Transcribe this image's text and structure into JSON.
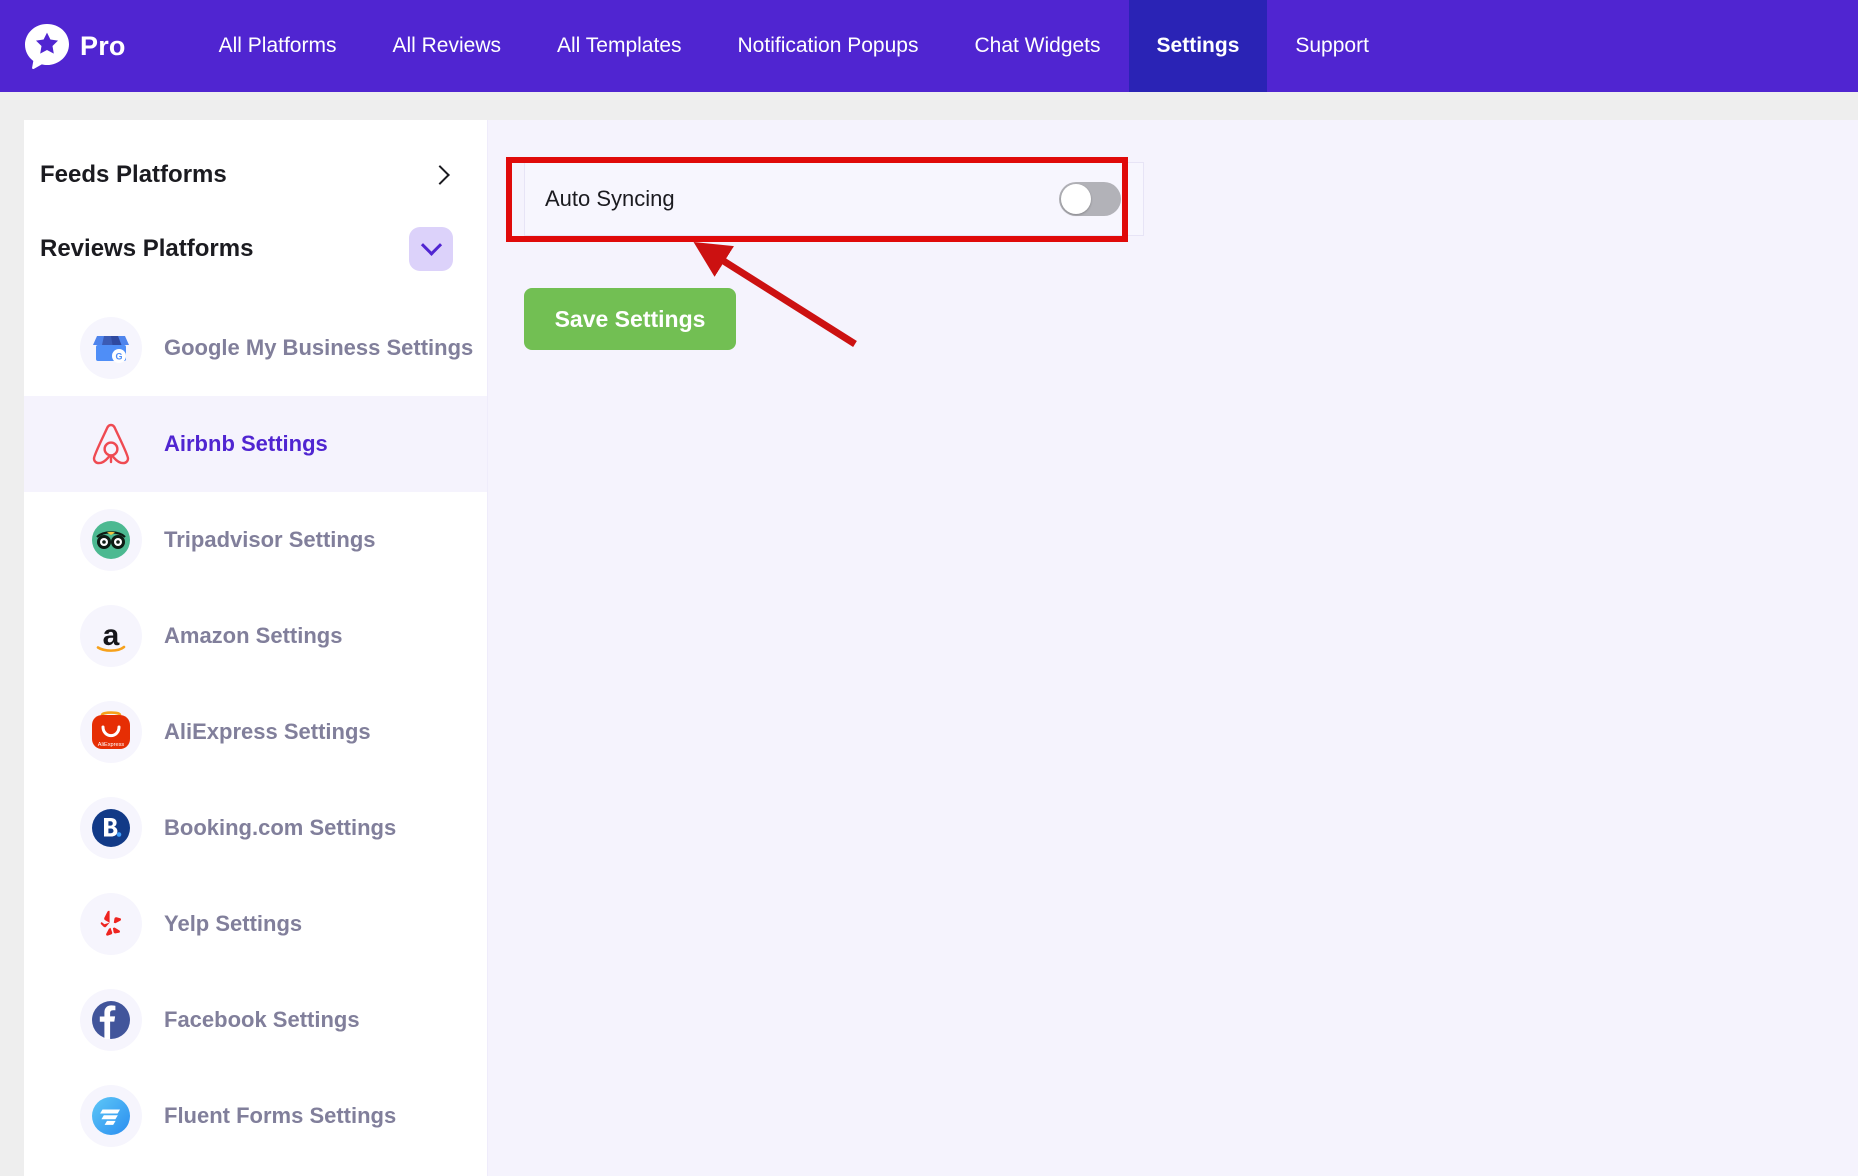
{
  "topnav": {
    "brand": {
      "logo_icon": "star-chat-bubble-logo",
      "name": "Pro",
      "accent": "#5025d1"
    },
    "items": [
      {
        "label": "All Platforms",
        "active": false
      },
      {
        "label": "All Reviews",
        "active": false
      },
      {
        "label": "All Templates",
        "active": false
      },
      {
        "label": "Notification Popups",
        "active": false
      },
      {
        "label": "Chat Widgets",
        "active": false
      },
      {
        "label": "Settings",
        "active": true
      },
      {
        "label": "Support",
        "active": false
      }
    ],
    "active_bg": "#2a23b5"
  },
  "sidebar": {
    "sections": [
      {
        "title": "Feeds Platforms",
        "icon": "chevron-right-icon",
        "expanded": false
      },
      {
        "title": "Reviews Platforms",
        "icon": "chevron-down-icon",
        "expanded": true
      }
    ],
    "items": [
      {
        "label": "Google My Business Settings",
        "icon": "google-my-business-icon",
        "active": false
      },
      {
        "label": "Airbnb Settings",
        "icon": "airbnb-icon",
        "active": true
      },
      {
        "label": "Tripadvisor Settings",
        "icon": "tripadvisor-icon",
        "active": false
      },
      {
        "label": "Amazon Settings",
        "icon": "amazon-icon",
        "active": false
      },
      {
        "label": "AliExpress Settings",
        "icon": "aliexpress-icon",
        "active": false
      },
      {
        "label": "Booking.com Settings",
        "icon": "booking-com-icon",
        "active": false
      },
      {
        "label": "Yelp Settings",
        "icon": "yelp-icon",
        "active": false
      },
      {
        "label": "Facebook Settings",
        "icon": "facebook-icon",
        "active": false
      },
      {
        "label": "Fluent Forms Settings",
        "icon": "fluent-forms-icon",
        "active": false
      }
    ],
    "active_label_color": "#5025d1",
    "label_color": "#817f9b"
  },
  "main": {
    "auto_syncing": {
      "label": "Auto Syncing",
      "enabled": false
    },
    "save_button": {
      "label": "Save Settings",
      "color": "#72bf53"
    }
  },
  "annotation": {
    "highlight_color": "#e00a0a",
    "target": "auto-syncing-row"
  }
}
